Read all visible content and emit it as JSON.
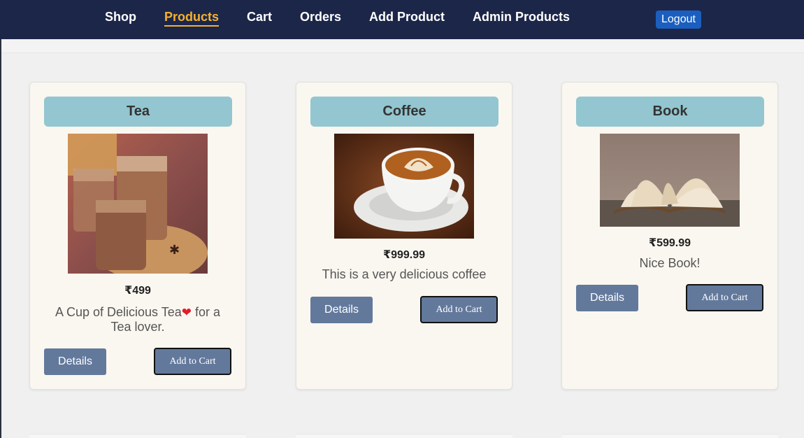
{
  "nav": {
    "links": [
      "Shop",
      "Products",
      "Cart",
      "Orders",
      "Add Product",
      "Admin Products"
    ],
    "active": "Products",
    "logout_label": "Logout"
  },
  "products": [
    {
      "title": "Tea",
      "price": "₹499",
      "description_before": "A Cup of Delicious Tea",
      "description_after": " for a Tea lover.",
      "details_label": "Details",
      "cart_label": "Add to Cart"
    },
    {
      "title": "Coffee",
      "price": "₹999.99",
      "description": "This is a very delicious coffee",
      "details_label": "Details",
      "cart_label": "Add to Cart"
    },
    {
      "title": "Book",
      "price": "₹599.99",
      "description": "Nice Book!",
      "details_label": "Details",
      "cart_label": "Add to Cart"
    }
  ],
  "colors": {
    "navbar": "#1c2649",
    "active_link": "#f2b131",
    "logout": "#1a5fbf",
    "card_title_bg": "#93c6d0",
    "button": "#63799c",
    "card_bg": "#faf7f0"
  },
  "icons": {
    "heart": "heart-emoji-icon"
  }
}
